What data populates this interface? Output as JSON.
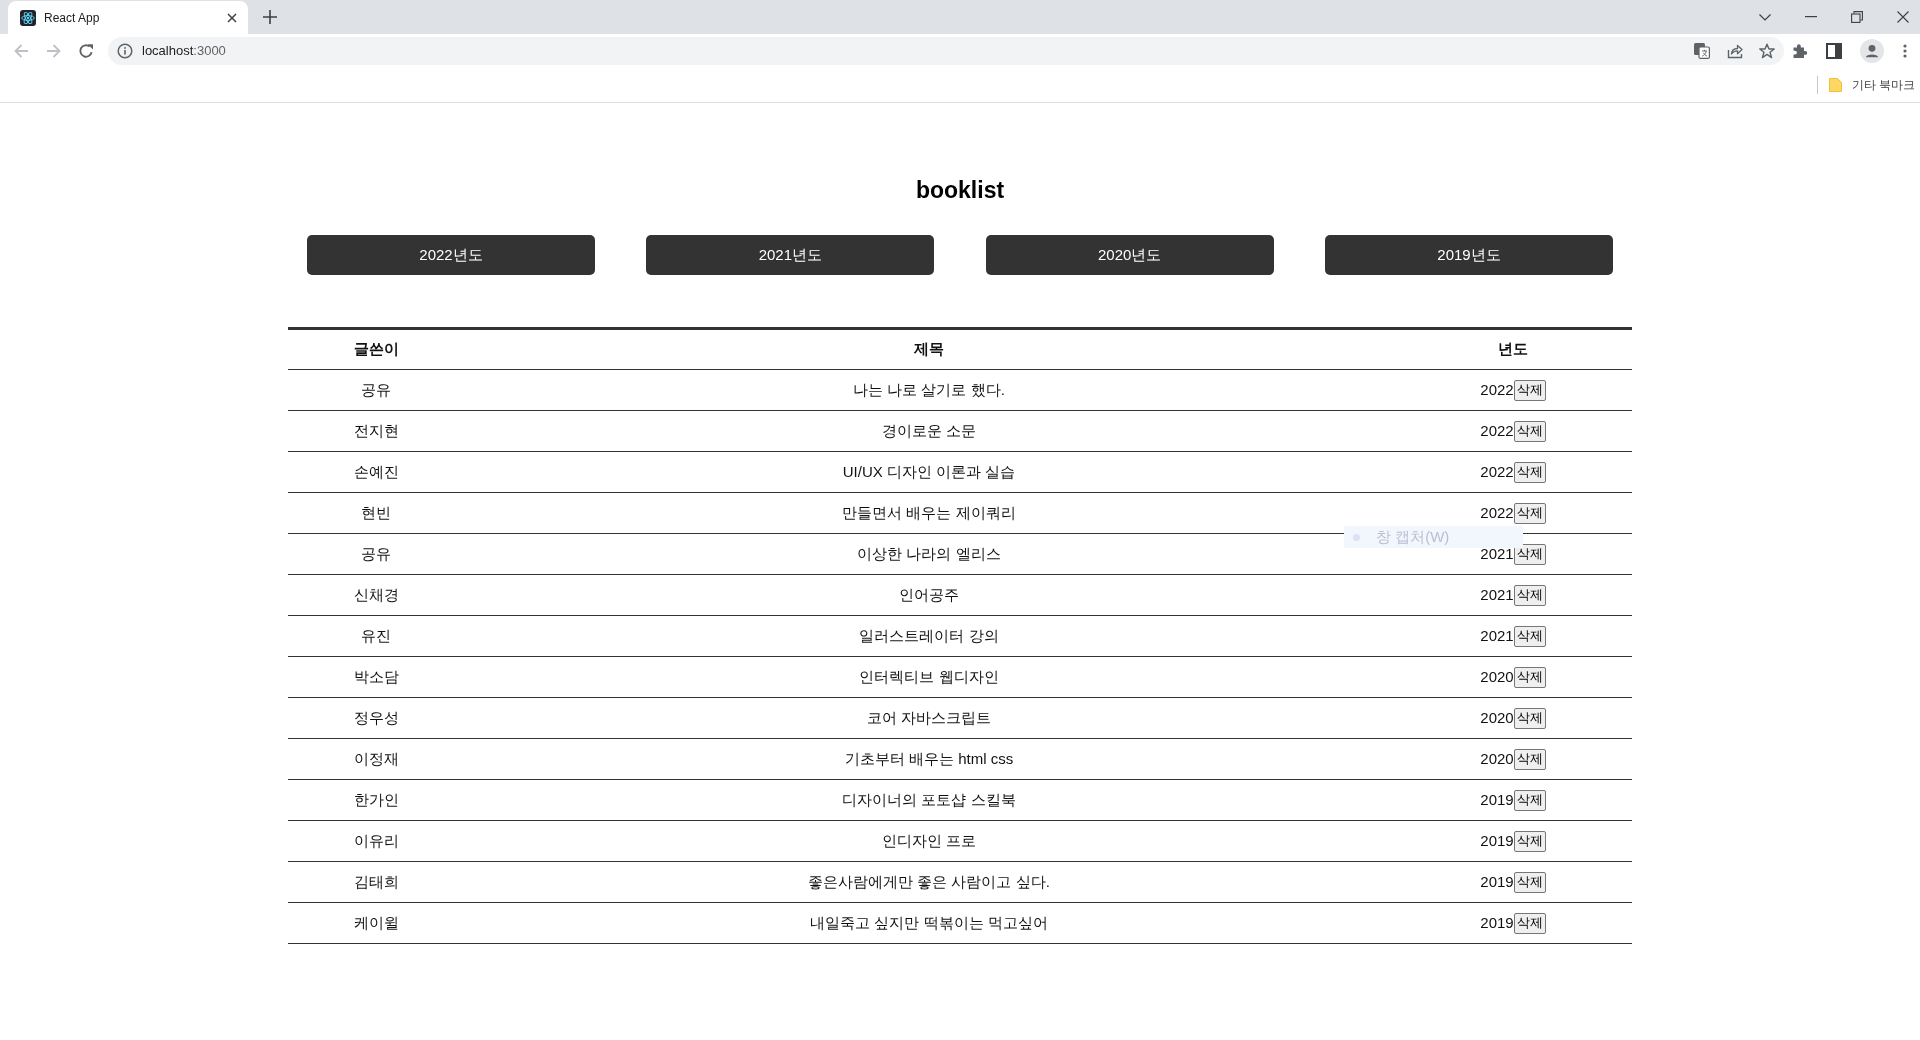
{
  "browser": {
    "tabs": [
      {
        "title": "React App",
        "selected": true
      }
    ],
    "navigation": {
      "back": {
        "disabled": true
      },
      "forward": {
        "disabled": true
      }
    },
    "address_bar": {
      "host": "localhost",
      "rest": ":3000"
    },
    "bookmarks_bar": {
      "items": [
        "기타 북마크"
      ]
    }
  },
  "page": {
    "title": "booklist",
    "year_buttons": [
      "2022년도",
      "2021년도",
      "2020년도",
      "2019년도"
    ],
    "table": {
      "columns": [
        "글쓴이",
        "제목",
        "년도"
      ],
      "rows": [
        {
          "author": "공유",
          "title": "나는 나로 살기로 했다.",
          "year": "2022",
          "action": "삭제"
        },
        {
          "author": "전지현",
          "title": "경이로운 소문",
          "year": "2022",
          "action": "삭제"
        },
        {
          "author": "손예진",
          "title": "UI/UX 디자인 이론과 실습",
          "year": "2022",
          "action": "삭제"
        },
        {
          "author": "현빈",
          "title": "만들면서 배우는 제이쿼리",
          "year": "2022",
          "action": "삭제"
        },
        {
          "author": "공유",
          "title": "이상한 나라의 엘리스",
          "year": "2021",
          "action": "삭제"
        },
        {
          "author": "신채경",
          "title": "인어공주",
          "year": "2021",
          "action": "삭제"
        },
        {
          "author": "유진",
          "title": "일러스트레이터 강의",
          "year": "2021",
          "action": "삭제"
        },
        {
          "author": "박소담",
          "title": "인터렉티브 웹디자인",
          "year": "2020",
          "action": "삭제"
        },
        {
          "author": "정우성",
          "title": "코어 자바스크립트",
          "year": "2020",
          "action": "삭제"
        },
        {
          "author": "이정재",
          "title": "기초부터 배우는 html css",
          "year": "2020",
          "action": "삭제"
        },
        {
          "author": "한가인",
          "title": "디자이너의 포토샵 스킬북",
          "year": "2019",
          "action": "삭제"
        },
        {
          "author": "이유리",
          "title": "인디자인 프로",
          "year": "2019",
          "action": "삭제"
        },
        {
          "author": "김태희",
          "title": "좋은사람에게만 좋은 사람이고 싶다.",
          "year": "2019",
          "action": "삭제"
        },
        {
          "author": "케이윌",
          "title": "내일죽고 싶지만 떡볶이는 먹고싶어",
          "year": "2019",
          "action": "삭제"
        }
      ]
    }
  },
  "overlay_menu": {
    "items": [
      {
        "label": "창 캡처(W)"
      }
    ]
  }
}
